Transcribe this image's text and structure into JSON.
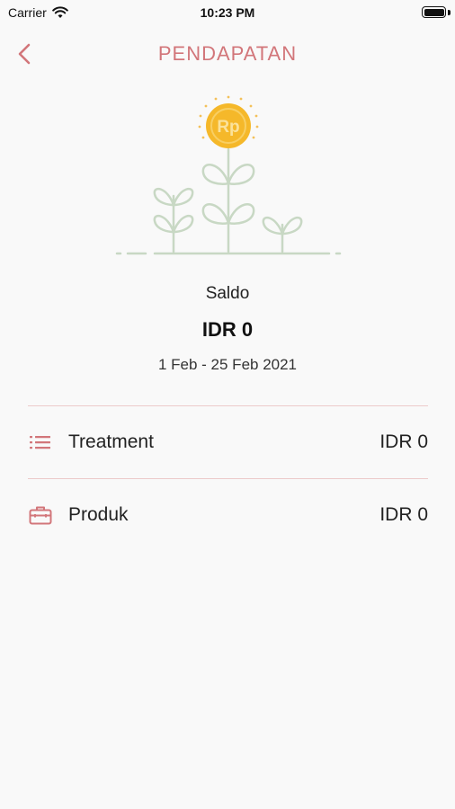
{
  "status_bar": {
    "carrier": "Carrier",
    "time": "10:23 PM"
  },
  "nav": {
    "title": "PENDAPATAN",
    "back_icon": "chevron-left-icon"
  },
  "illustration": {
    "coin_label": "Rp",
    "coin_color": "#f5b82a",
    "plant_color": "#c8d8c4"
  },
  "summary": {
    "label": "Saldo",
    "amount": "IDR 0",
    "period": "1 Feb - 25 Feb 2021"
  },
  "rows": [
    {
      "icon": "list-icon",
      "label": "Treatment",
      "value": "IDR 0"
    },
    {
      "icon": "briefcase-icon",
      "label": "Produk",
      "value": "IDR 0"
    }
  ],
  "colors": {
    "accent": "#d2767a",
    "divider": "#eccaca",
    "background": "#f9f9f9"
  }
}
